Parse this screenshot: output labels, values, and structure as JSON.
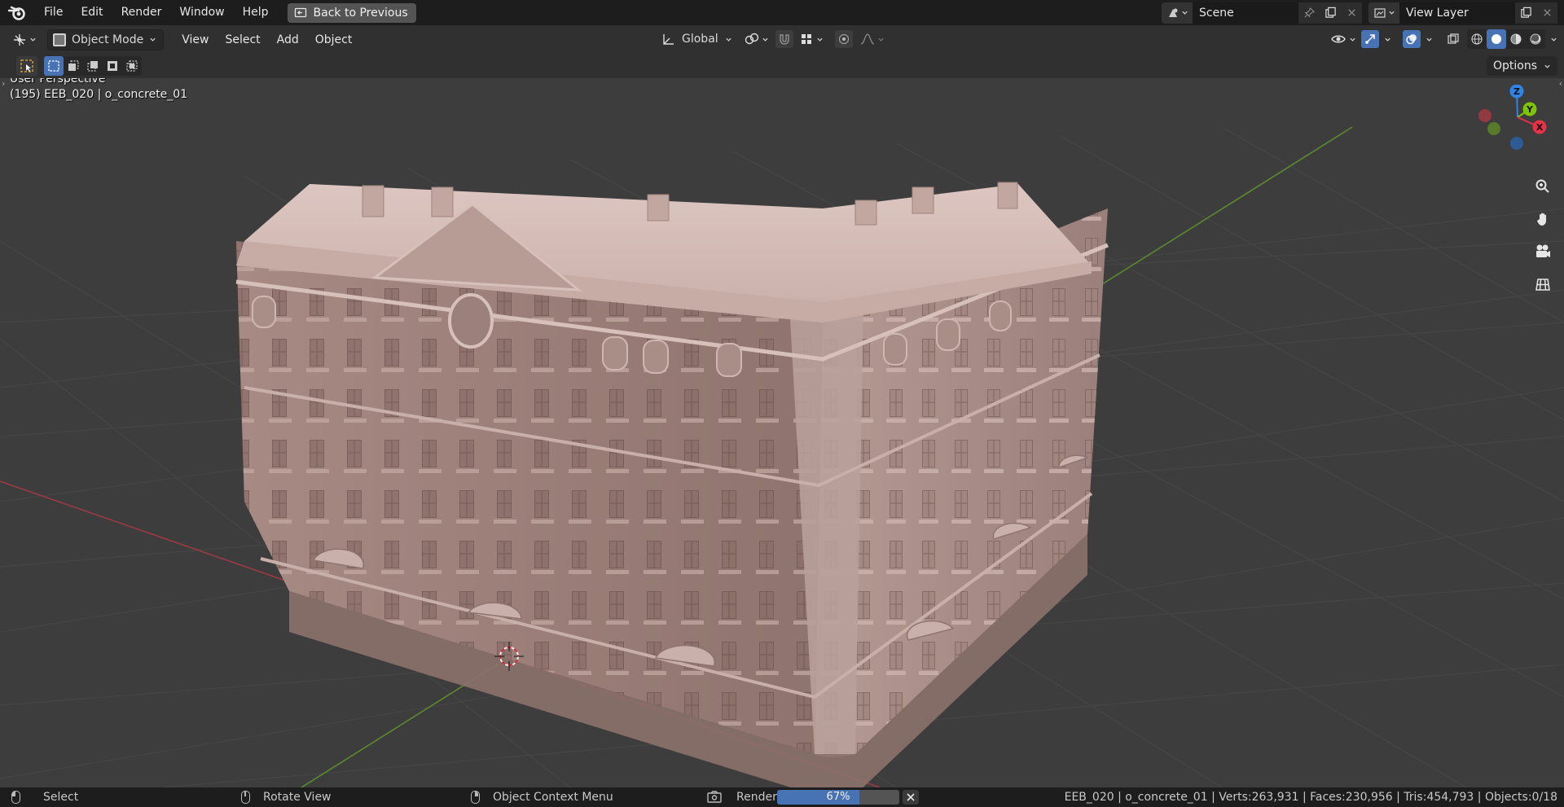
{
  "topbar": {
    "menus": [
      "File",
      "Edit",
      "Render",
      "Window",
      "Help"
    ],
    "back_label": "Back to Previous",
    "scene_name": "Scene",
    "view_layer": "View Layer"
  },
  "header": {
    "mode": "Object Mode",
    "menus": [
      "View",
      "Select",
      "Add",
      "Object"
    ],
    "orientation": "Global"
  },
  "toolrow": {
    "options_label": "Options"
  },
  "viewport": {
    "perspective": "User Perspective",
    "object_info": "(195) EEB_020 | o_concrete_01",
    "gizmo": {
      "z": "Z",
      "y": "Y",
      "x": "X"
    }
  },
  "statusbar": {
    "select": "Select",
    "rotate": "Rotate View",
    "context": "Object Context Menu",
    "render_label": "Render",
    "progress_text": "67%",
    "progress_value": 0.67,
    "stats": "EEB_020 | o_concrete_01 | Verts:263,931 | Faces:230,956 | Tris:454,793 | Objects:0/18"
  },
  "colors": {
    "accent": "#4772b3",
    "viewport_bg": "#3d3d3d",
    "axis_x": "#ff3352",
    "axis_y": "#8bdc00",
    "axis_z": "#2890ff",
    "building": "#b89c96"
  }
}
